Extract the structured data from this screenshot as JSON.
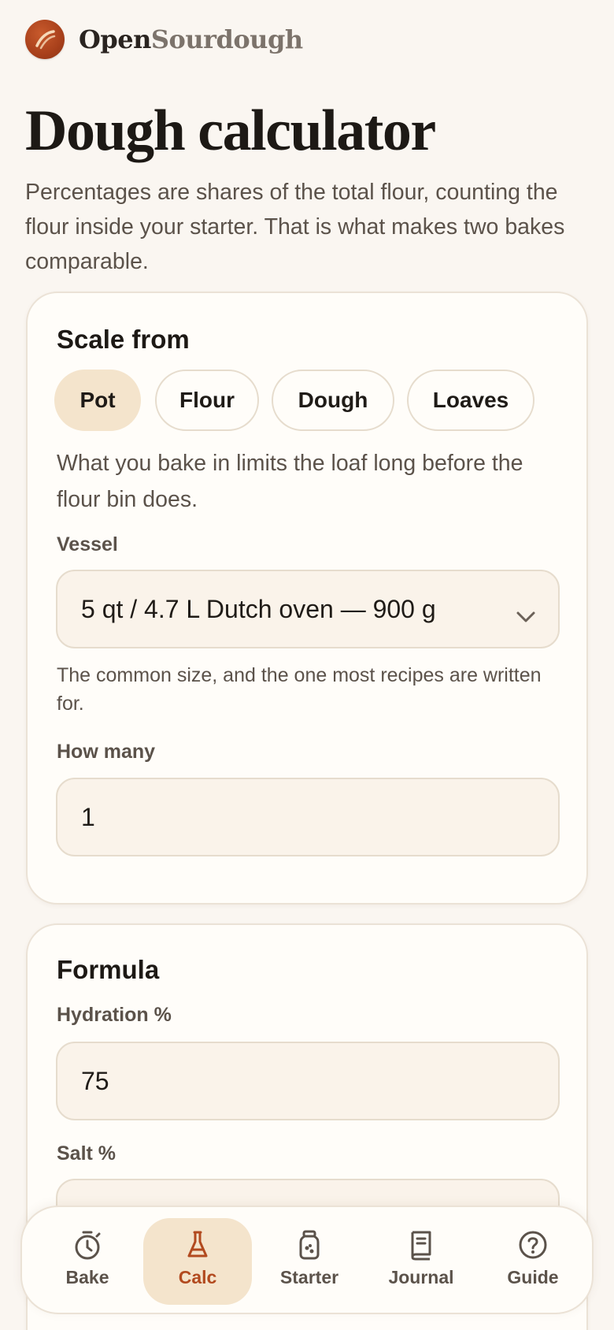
{
  "brand": {
    "part1": "Open",
    "part2": "Sourdough",
    "logo_icon": "bread-loaf-icon"
  },
  "page": {
    "title": "Dough calculator",
    "intro": "Percentages are shares of the total flour, counting the flour inside your starter. That is what makes two bakes comparable."
  },
  "scale": {
    "title": "Scale from",
    "options": [
      "Pot",
      "Flour",
      "Dough",
      "Loaves"
    ],
    "selected": "Pot",
    "description": "What you bake in limits the loaf long before the flour bin does.",
    "vessel_label": "Vessel",
    "vessel_value": "5 qt / 4.7 L Dutch oven — 900 g",
    "vessel_hint": "The common size, and the one most recipes are written for.",
    "count_label": "How many",
    "count_value": "1"
  },
  "formula": {
    "title": "Formula",
    "hydration_label": "Hydration %",
    "hydration_value": "75",
    "salt_label": "Salt %",
    "salt_value": ""
  },
  "tabs": [
    {
      "label": "Bake",
      "icon": "timer-icon"
    },
    {
      "label": "Calc",
      "icon": "flask-icon"
    },
    {
      "label": "Starter",
      "icon": "jar-icon"
    },
    {
      "label": "Journal",
      "icon": "book-icon"
    },
    {
      "label": "Guide",
      "icon": "help-circle-icon"
    }
  ],
  "active_tab": "Calc",
  "colors": {
    "background": "#faf6f1",
    "card": "#fffdf9",
    "accent": "#b24a1f",
    "accent_bg": "#f4e4cc",
    "text": "#1f1b17",
    "muted": "#5b524a"
  }
}
